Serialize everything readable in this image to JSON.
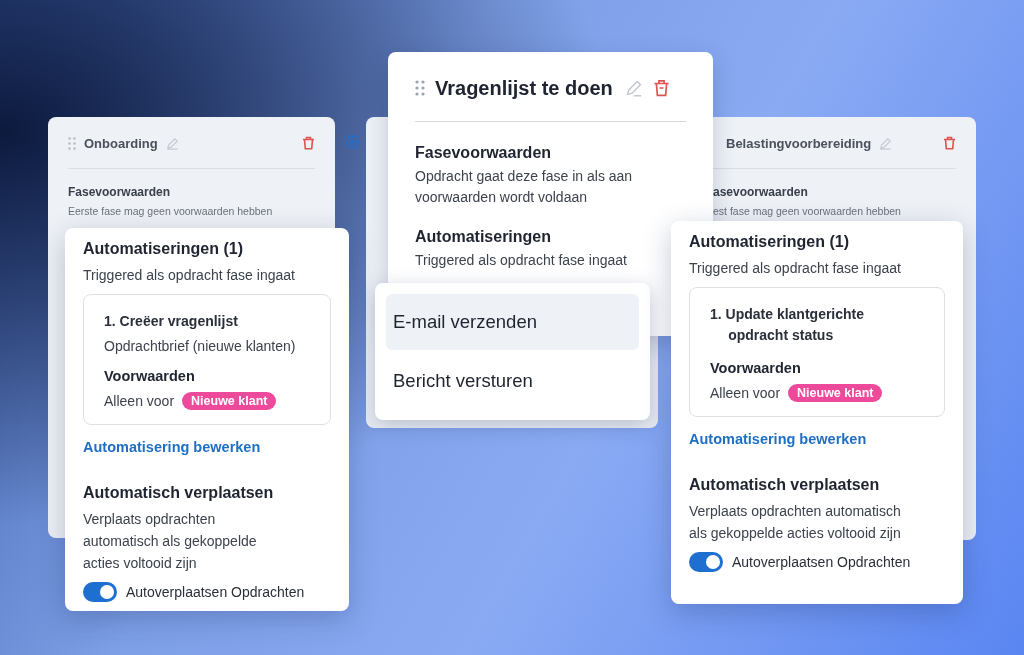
{
  "back_columns": [
    {
      "title": "Onboarding",
      "section_title": "Fasevoorwaarden",
      "section_text": "Eerste fase mag geen voorwaarden hebben"
    },
    {
      "title": "Belastingvoorbereiding",
      "section_title": "asevoorwaarden",
      "section_text": "est fase mag geen voorwaarden hebben"
    }
  ],
  "phase_card": {
    "title": "Vragenlijst te doen",
    "sections": [
      {
        "heading": "Fasevoorwaarden",
        "text": "Opdracht gaat deze fase in als aan voorwaarden wordt voldaan"
      },
      {
        "heading": "Automatiseringen",
        "text": "Triggered als opdracht fase ingaat"
      }
    ]
  },
  "action_menu": {
    "items": [
      {
        "label": "E-mail verzenden",
        "selected": true
      },
      {
        "label": "Bericht versturen",
        "selected": false
      }
    ]
  },
  "automation_cards": [
    {
      "heading": "Automatiseringen (1)",
      "trigger": "Triggered als opdracht fase ingaat",
      "automation": {
        "title": "1. Creëer vragenlijst",
        "detail": "Opdrachtbrief (nieuwe klanten)"
      },
      "conditions_heading": "Voorwaarden",
      "conditions_label": "Alleen voor",
      "tag": {
        "label": "Nieuwe klant",
        "color": "#ee4a9c"
      },
      "edit_link": "Automatisering bewerken",
      "move_heading": "Automatisch verplaatsen",
      "move_text": "Verplaats opdrachten automatisch als gekoppelde acties voltooid zijn",
      "toggle": {
        "label": "Autoverplaatsen Opdrachten",
        "on": true
      }
    },
    {
      "heading": "Automatiseringen (1)",
      "trigger": "Triggered als opdracht fase ingaat",
      "automation": {
        "title": "1. Update klantgerichte opdracht status"
      },
      "conditions_heading": "Voorwaarden",
      "conditions_label": "Alleen voor",
      "tag": {
        "label": "Nieuwe klant",
        "color": "#ee4a9c"
      },
      "edit_link": "Automatisering bewerken",
      "move_heading": "Automatisch verplaatsen",
      "move_text": "Verplaats opdrachten automatisch als gekoppelde acties voltooid zijn",
      "toggle": {
        "label": "Autoverplaatsen Opdrachten",
        "on": true
      }
    }
  ]
}
